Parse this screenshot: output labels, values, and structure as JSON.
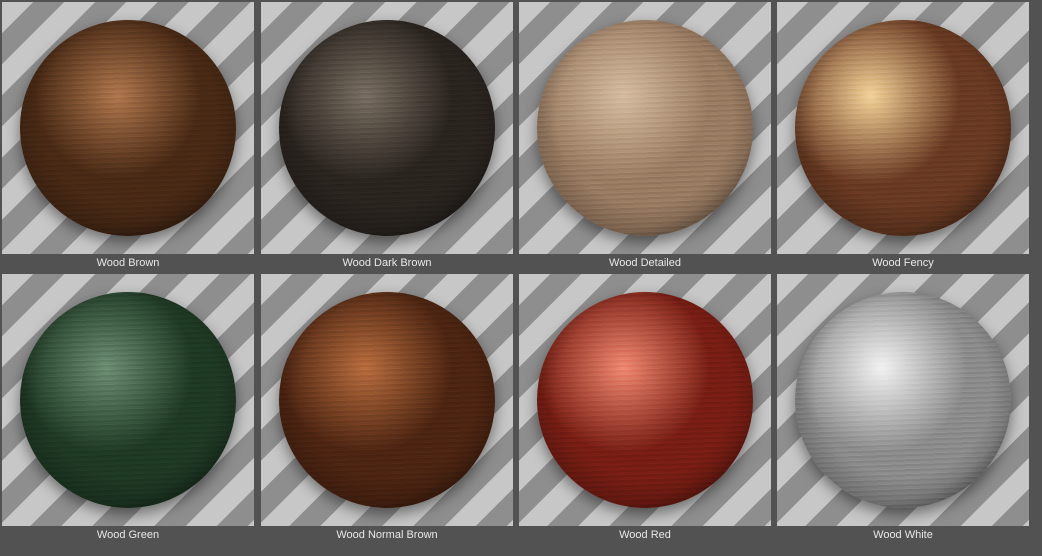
{
  "materials": [
    {
      "label": "Wood Brown",
      "base": "#4a2a15",
      "light": "#b0784e",
      "spot": "45% 35%"
    },
    {
      "label": "Wood Dark Brown",
      "base": "#2b2520",
      "light": "#7a6f62",
      "spot": "40% 35%"
    },
    {
      "label": "Wood Detailed",
      "base": "#9a7d63",
      "light": "#d6bda2",
      "spot": "40% 35%"
    },
    {
      "label": "Wood Fency",
      "base": "#6a3a22",
      "light": "#f3d39a",
      "spot": "35% 35%"
    },
    {
      "label": "Wood Green",
      "base": "#1f3a25",
      "light": "#6d8f73",
      "spot": "40% 35%"
    },
    {
      "label": "Wood Normal Brown",
      "base": "#4e2512",
      "light": "#b86e3e",
      "spot": "40% 35%"
    },
    {
      "label": "Wood Red",
      "base": "#7a1e14",
      "light": "#f08a72",
      "spot": "40% 35%"
    },
    {
      "label": "Wood White",
      "base": "#8d8d8d",
      "light": "#f2f2f2",
      "spot": "40% 35%"
    }
  ]
}
